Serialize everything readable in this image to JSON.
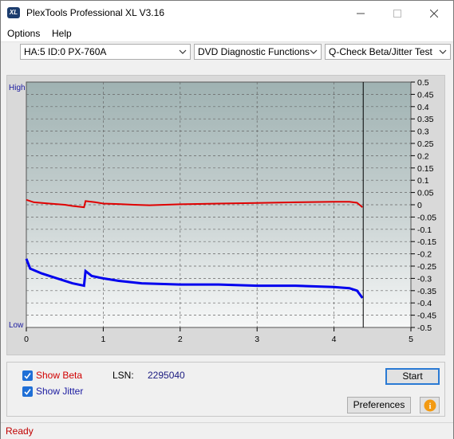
{
  "window": {
    "title": "PlexTools Professional XL V3.16",
    "icon_text": "XL"
  },
  "menu": {
    "options": "Options",
    "help": "Help"
  },
  "toolbar": {
    "drive": "HA:5 ID:0  PX-760A",
    "function": "DVD Diagnostic Functions",
    "test": "Q-Check Beta/Jitter Test"
  },
  "chart_data": {
    "type": "line",
    "left_axis_labels": {
      "top": "High",
      "bottom": "Low"
    },
    "x": {
      "ticks": [
        "0",
        "1",
        "2",
        "3",
        "4",
        "5"
      ],
      "range": [
        0,
        5
      ]
    },
    "y_right": {
      "ticks": [
        "0.5",
        "0.45",
        "0.4",
        "0.35",
        "0.3",
        "0.25",
        "0.2",
        "0.15",
        "0.1",
        "0.05",
        "0",
        "-0.05",
        "-0.1",
        "-0.15",
        "-0.2",
        "-0.25",
        "-0.3",
        "-0.35",
        "-0.4",
        "-0.45",
        "-0.5"
      ],
      "range": [
        -0.5,
        0.5
      ]
    },
    "cursor_x": 4.38,
    "series": [
      {
        "name": "Beta",
        "color": "#e00000",
        "points": [
          [
            0,
            0.02
          ],
          [
            0.1,
            0.01
          ],
          [
            0.3,
            0.005
          ],
          [
            0.5,
            0.0
          ],
          [
            0.6,
            -0.005
          ],
          [
            0.75,
            -0.01
          ],
          [
            0.77,
            0.015
          ],
          [
            0.9,
            0.01
          ],
          [
            1.0,
            0.005
          ],
          [
            1.2,
            0.003
          ],
          [
            1.4,
            0.0
          ],
          [
            1.6,
            -0.002
          ],
          [
            1.8,
            0.0
          ],
          [
            2.0,
            0.002
          ],
          [
            2.5,
            0.005
          ],
          [
            3.0,
            0.007
          ],
          [
            3.5,
            0.01
          ],
          [
            4.0,
            0.012
          ],
          [
            4.2,
            0.012
          ],
          [
            4.3,
            0.008
          ],
          [
            4.37,
            -0.01
          ]
        ]
      },
      {
        "name": "Jitter",
        "color": "#0000ee",
        "points": [
          [
            0,
            -0.22
          ],
          [
            0.05,
            -0.26
          ],
          [
            0.2,
            -0.28
          ],
          [
            0.4,
            -0.3
          ],
          [
            0.6,
            -0.32
          ],
          [
            0.75,
            -0.33
          ],
          [
            0.77,
            -0.27
          ],
          [
            0.85,
            -0.29
          ],
          [
            1.0,
            -0.3
          ],
          [
            1.2,
            -0.31
          ],
          [
            1.5,
            -0.32
          ],
          [
            2.0,
            -0.325
          ],
          [
            2.5,
            -0.325
          ],
          [
            3.0,
            -0.33
          ],
          [
            3.5,
            -0.33
          ],
          [
            4.0,
            -0.335
          ],
          [
            4.2,
            -0.34
          ],
          [
            4.3,
            -0.35
          ],
          [
            4.37,
            -0.38
          ]
        ]
      }
    ]
  },
  "controls": {
    "show_beta": "Show Beta",
    "show_jitter": "Show Jitter",
    "lsn_label": "LSN:",
    "lsn_value": "2295040",
    "start": "Start",
    "preferences": "Preferences",
    "info_icon": "i"
  },
  "status": {
    "text": "Ready"
  }
}
